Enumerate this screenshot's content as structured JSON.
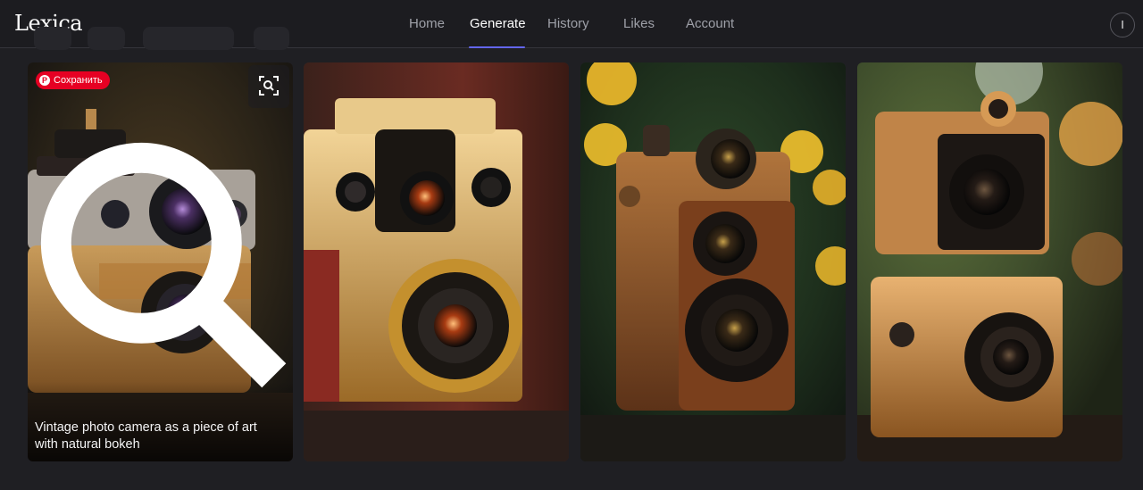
{
  "app": {
    "logo": "Lexica"
  },
  "nav": {
    "items": [
      {
        "label": "Home",
        "active": false
      },
      {
        "label": "Generate",
        "active": true
      },
      {
        "label": "History",
        "active": false
      },
      {
        "label": "Likes",
        "active": false
      },
      {
        "label": "Account",
        "active": false
      }
    ],
    "avatar_initial": "I",
    "accent_color": "#6366f1"
  },
  "gallery": {
    "cards": [
      {
        "caption": "Vintage photo camera as a piece of art with natural bokeh",
        "save_label": "Сохранить",
        "icons": [
          "pinterest-icon",
          "zoom-icon",
          "visual-search-icon"
        ]
      },
      {
        "caption": ""
      },
      {
        "caption": ""
      },
      {
        "caption": ""
      }
    ]
  }
}
